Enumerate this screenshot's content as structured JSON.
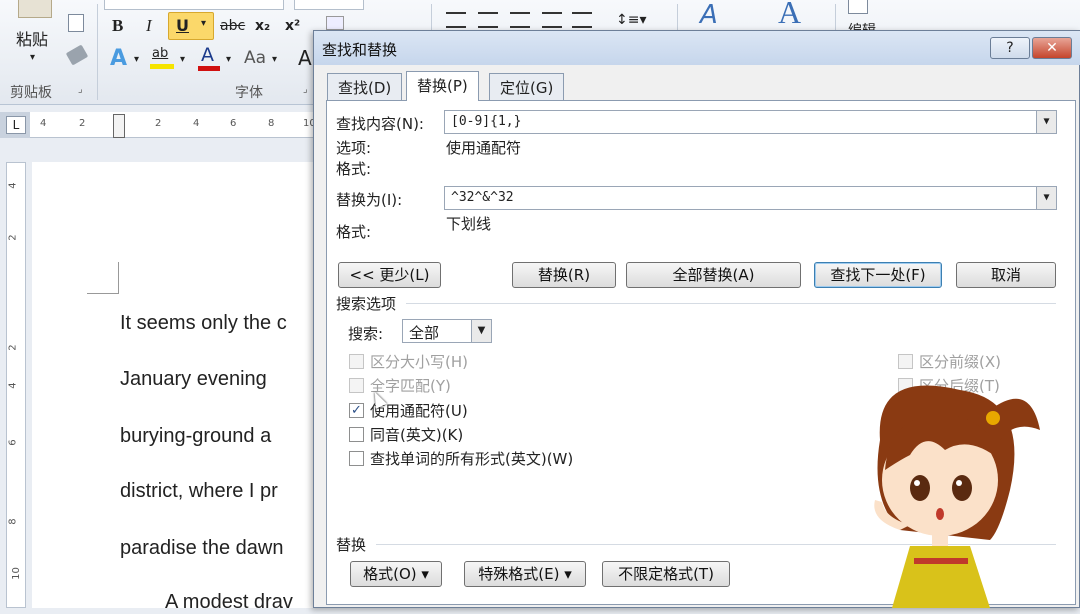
{
  "ribbon": {
    "paste_label": "粘贴",
    "clipboard_group": "剪贴板",
    "font_group": "字体",
    "bold": "B",
    "italic": "I",
    "underline": "U",
    "strike": "abc",
    "subscript": "x₂",
    "superscript": "x²",
    "text_effect": "A",
    "highlight": "ab",
    "font_color": "A",
    "change_case": "Aa",
    "grow_font": "A",
    "styles_a": "A",
    "edit_label": "编辑"
  },
  "ruler": {
    "numbers": [
      "4",
      "2",
      "2",
      "4",
      "6",
      "8",
      "10"
    ],
    "v_numbers": [
      "4",
      "2",
      "2",
      "4",
      "6",
      "8",
      "10"
    ],
    "corner": "L"
  },
  "document": {
    "lines": [
      "It seems only the c",
      "January   evening",
      "burying-ground  a",
      "district, where I pr",
      "paradise the dawn",
      "A modest drav"
    ]
  },
  "dialog": {
    "title": "查找和替换",
    "help": "?",
    "close": "✕",
    "tabs": [
      "查找(D)",
      "替换(P)",
      "定位(G)"
    ],
    "find_label": "查找内容(N):",
    "find_value": "[0-9]{1,}",
    "options_label": "选项:",
    "options_value": "使用通配符",
    "format_label": "格式:",
    "replace_label": "替换为(I):",
    "replace_value": "^32^&^32",
    "replace_format_label": "格式:",
    "replace_format_value": "下划线",
    "buttons": {
      "less": "<< 更少(L)",
      "replace": "替换(R)",
      "replace_all": "全部替换(A)",
      "find_next": "查找下一处(F)",
      "cancel": "取消"
    },
    "search_options_title": "搜索选项",
    "search_label": "搜索:",
    "search_value": "全部",
    "checkboxes_left": [
      {
        "label": "区分大小写(H)",
        "checked": false,
        "disabled": true
      },
      {
        "label": "全字匹配(Y)",
        "checked": false,
        "disabled": true
      },
      {
        "label": "使用通配符(U)",
        "checked": true,
        "disabled": false
      },
      {
        "label": "同音(英文)(K)",
        "checked": false,
        "disabled": false
      },
      {
        "label": "查找单词的所有形式(英文)(W)",
        "checked": false,
        "disabled": false
      }
    ],
    "checkboxes_right": [
      {
        "label": "区分前缀(X)",
        "checked": false,
        "disabled": true
      },
      {
        "label": "区分后缀(T)",
        "checked": false,
        "disabled": true
      }
    ],
    "replace_section_title": "替换",
    "bottom_buttons": {
      "format": "格式(O) ▾",
      "special": "特殊格式(E) ▾",
      "no_format": "不限定格式(T)"
    }
  },
  "colors": {
    "highlight_yellow": "#f5e400",
    "font_red": "#d01010",
    "char_dress": "#d9c21a",
    "char_hair": "#8a3a12"
  }
}
